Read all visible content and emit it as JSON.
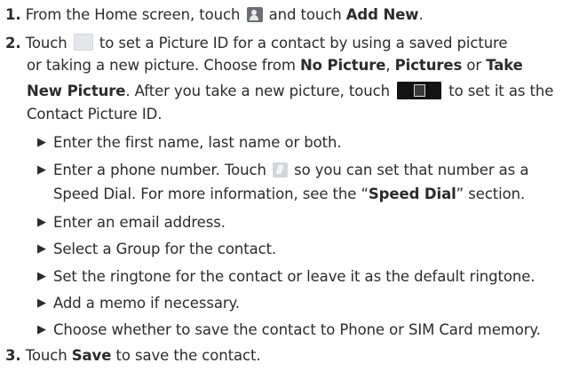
{
  "steps": [
    {
      "number": "1.",
      "segments": [
        "From the Home screen, touch",
        "and touch",
        "Add New",
        "."
      ]
    },
    {
      "number": "2.",
      "segments": [
        "Touch",
        "to set a Picture ID for a contact by using a saved picture",
        "or taking a new picture. Choose from",
        "No Picture",
        ",",
        "Pictures",
        "or",
        "Take",
        "New Picture",
        ". After you take a new picture, touch",
        "to set it as the",
        "Contact Picture ID."
      ]
    },
    {
      "number": "3.",
      "segments": [
        "Touch",
        "Save",
        "to save the contact."
      ]
    }
  ],
  "bullets": [
    {
      "text": "Enter the first name, last name or both."
    },
    {
      "segments": [
        "Enter a phone number. Touch",
        "so you can set that number as a",
        "Speed Dial. For more information, see the “",
        "Speed Dial",
        "” section."
      ]
    },
    {
      "text": "Enter an email address."
    },
    {
      "text": "Select a Group for the contact."
    },
    {
      "text": "Set the ringtone for the contact or leave it as the default ringtone."
    },
    {
      "text": "Add a memo if necessary."
    },
    {
      "text": "Choose whether to save the contact to Phone or SIM Card memory."
    }
  ],
  "bullet_glyph": "▶",
  "icons": {
    "contacts": "contacts-app-icon",
    "picture": "picture-placeholder-icon",
    "set_picture": "set-picture-button-icon",
    "speed_dial": "speed-dial-icon"
  },
  "colors": {
    "text": "#2b2b2b",
    "icon_dark": "#131313"
  }
}
